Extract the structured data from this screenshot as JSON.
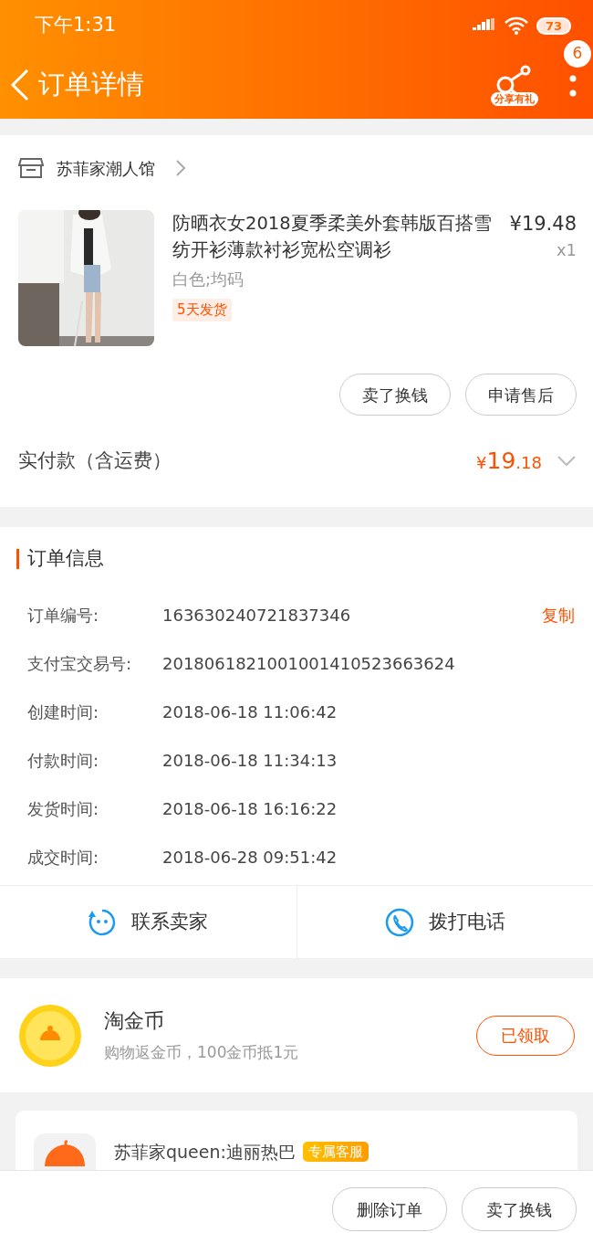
{
  "status_bar": {
    "time": "下午1:31",
    "battery": "73"
  },
  "header": {
    "title": "订单详情",
    "share_label": "分享有礼",
    "badge": "6"
  },
  "shop": {
    "name": "苏菲家潮人馆"
  },
  "product": {
    "kind": "picture",
    "title": "防晒衣女2018夏季柔美外套韩版百搭雪纺开衫薄款衬衫宽松空调衫",
    "price": "¥19.48",
    "quantity": "x1",
    "sku": "白色;均码",
    "tag": "5天发货"
  },
  "item_buttons": [
    "卖了换钱",
    "申请售后"
  ],
  "payment": {
    "label": "实付款（含运费）",
    "currency": "¥",
    "amount_int": "19",
    "amount_dec": ".18"
  },
  "order_info": {
    "title": "订单信息",
    "rows": [
      {
        "label": "订单编号:",
        "value": "163630240721837346",
        "action": "复制"
      },
      {
        "label": "支付宝交易号:",
        "value": "2018061821001001410523663624"
      },
      {
        "label": "创建时间:",
        "value": "2018-06-18 11:06:42"
      },
      {
        "label": "付款时间:",
        "value": "2018-06-18 11:34:13"
      },
      {
        "label": "发货时间:",
        "value": "2018-06-18 16:16:22"
      },
      {
        "label": "成交时间:",
        "value": "2018-06-28 09:51:42"
      }
    ]
  },
  "contact_actions": [
    {
      "kind": "chat",
      "label": "联系卖家"
    },
    {
      "kind": "phone",
      "label": "拨打电话"
    }
  ],
  "coins": {
    "title": "淘金币",
    "subtitle": "购物返金币，100金币抵1元",
    "button": "已领取"
  },
  "message": {
    "sender": "苏菲家queen:迪丽热巴",
    "tag": "专属客服"
  },
  "bottom_buttons": [
    "删除订单",
    "卖了换钱"
  ]
}
